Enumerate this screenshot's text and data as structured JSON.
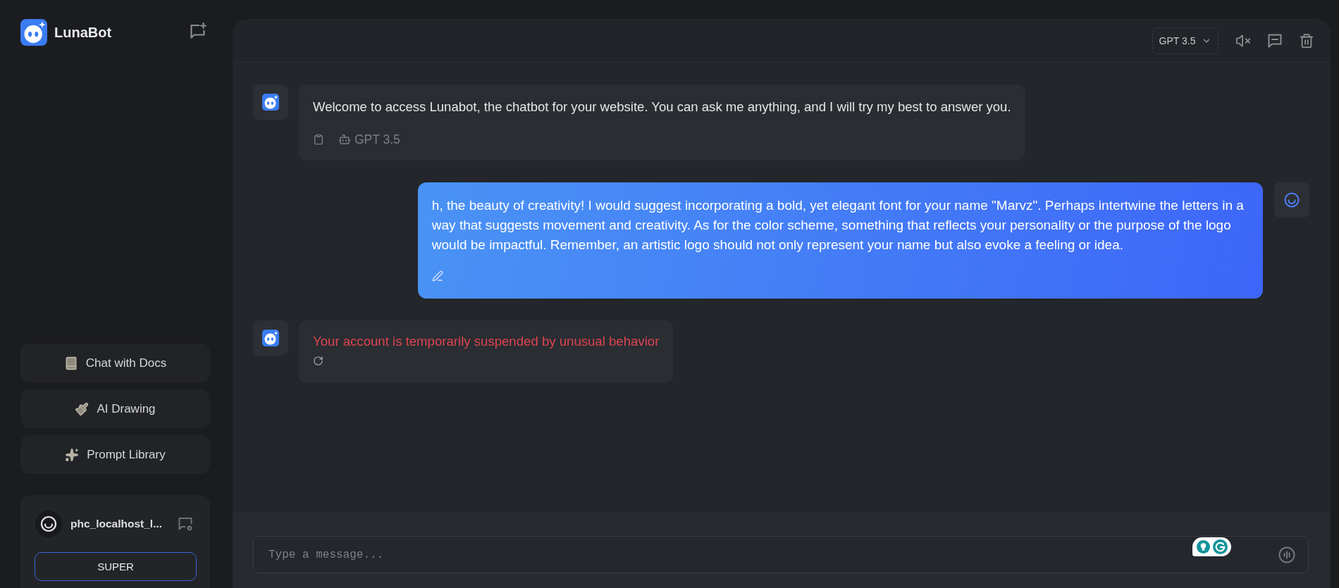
{
  "sidebar": {
    "brand": "LunaBot",
    "menu": [
      {
        "kind": "docs",
        "label": "Chat with Docs"
      },
      {
        "kind": "drawing",
        "label": "AI Drawing"
      },
      {
        "kind": "prompts",
        "label": "Prompt Library"
      }
    ],
    "account": {
      "name": "phc_localhost_l...",
      "plan": "SUPER"
    }
  },
  "header": {
    "model": "GPT 3.5"
  },
  "messages": [
    {
      "kind": "bot",
      "text": "Welcome to access Lunabot, the chatbot for your website. You can ask me anything, and I will try my best to answer you.",
      "model": "GPT 3.5"
    },
    {
      "kind": "user",
      "text": "h, the beauty of creativity! I would suggest incorporating a bold, yet elegant font for your name \"Marvz\". Perhaps intertwine the letters in a way that suggests movement and creativity. As for the color scheme, something that reflects your personality or the purpose of the logo would be impactful. Remember, an artistic logo should not only represent your name but also evoke a feeling or idea."
    },
    {
      "kind": "error",
      "text": "Your account is temporarily suspended by unusual behavior"
    }
  ],
  "composer": {
    "placeholder": "Type a message..."
  }
}
